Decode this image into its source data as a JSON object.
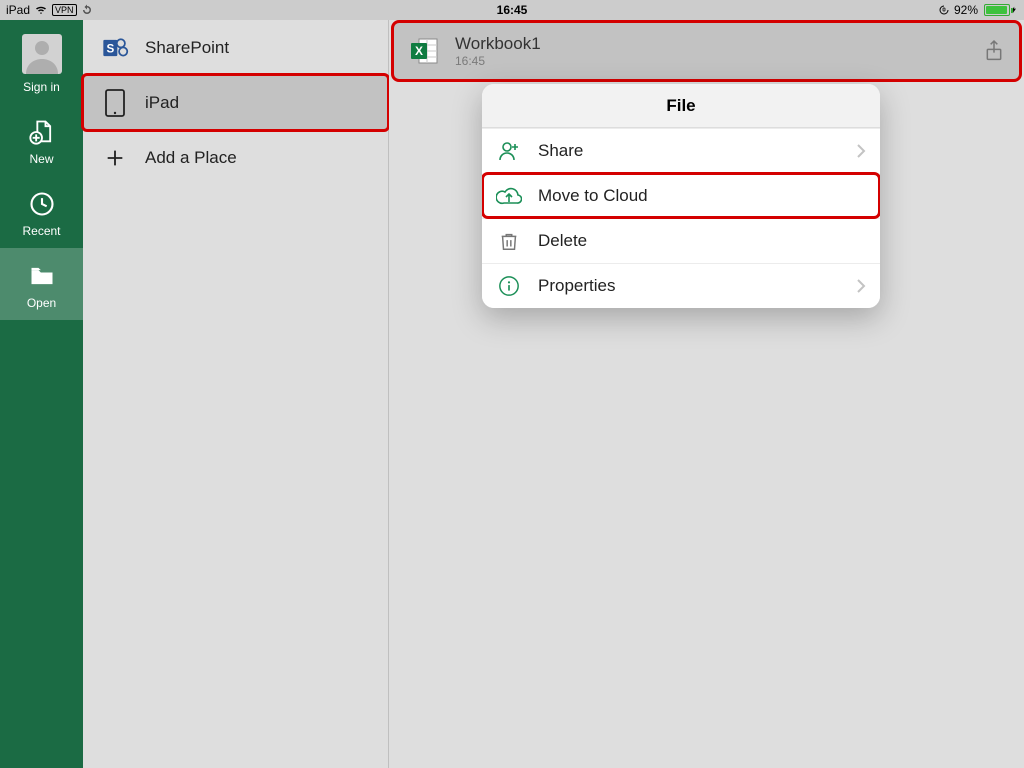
{
  "status": {
    "carrier": "iPad",
    "vpn": "VPN",
    "time": "16:45",
    "battery_pct": "92%"
  },
  "sidebar": {
    "signin": "Sign in",
    "new": "New",
    "recent": "Recent",
    "open": "Open"
  },
  "places": {
    "sharepoint": "SharePoint",
    "ipad": "iPad",
    "add": "Add a Place"
  },
  "file": {
    "name": "Workbook1",
    "time": "16:45"
  },
  "popover": {
    "title": "File",
    "share": "Share",
    "move": "Move to Cloud",
    "delete": "Delete",
    "properties": "Properties"
  }
}
